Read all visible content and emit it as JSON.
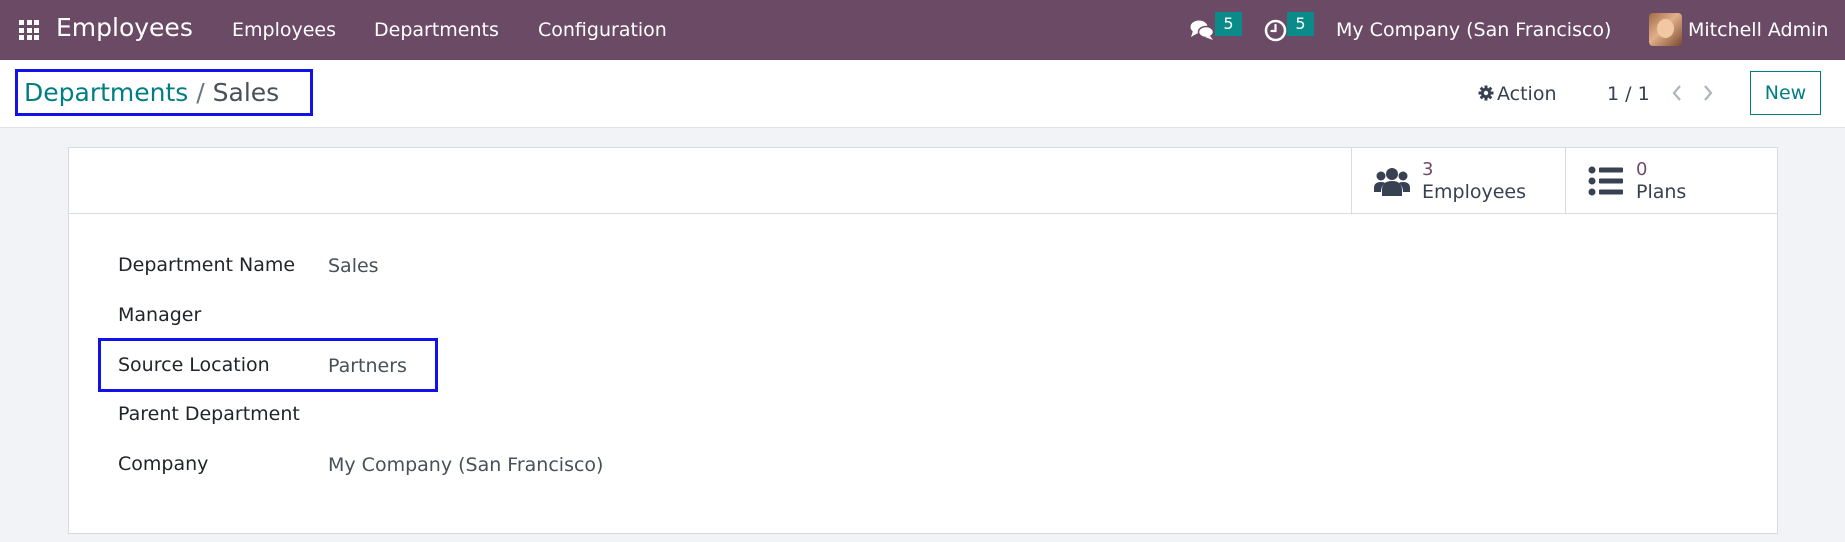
{
  "navbar": {
    "app_title": "Employees",
    "menu": [
      "Employees",
      "Departments",
      "Configuration"
    ],
    "messages_count": "5",
    "activities_count": "5",
    "company": "My Company (San Francisco)",
    "user": "Mitchell Admin",
    "background": "#6b4a66"
  },
  "breadcrumb": {
    "parent": "Departments",
    "separator": "/",
    "current": "Sales"
  },
  "control": {
    "action_label": "Action",
    "pager": "1 / 1",
    "new_label": "New"
  },
  "smart_buttons": [
    {
      "count": "3",
      "label": "Employees",
      "icon": "users-icon"
    },
    {
      "count": "0",
      "label": "Plans",
      "icon": "list-icon"
    }
  ],
  "form": {
    "fields": [
      {
        "label": "Department Name",
        "value": "Sales"
      },
      {
        "label": "Manager",
        "value": ""
      },
      {
        "label": "Source Location",
        "value": "Partners"
      },
      {
        "label": "Parent Department",
        "value": ""
      },
      {
        "label": "Company",
        "value": "My Company (San Francisco)"
      }
    ]
  },
  "colors": {
    "accent": "#017e84",
    "brand": "#714b67",
    "highlight": "#1212e8"
  }
}
